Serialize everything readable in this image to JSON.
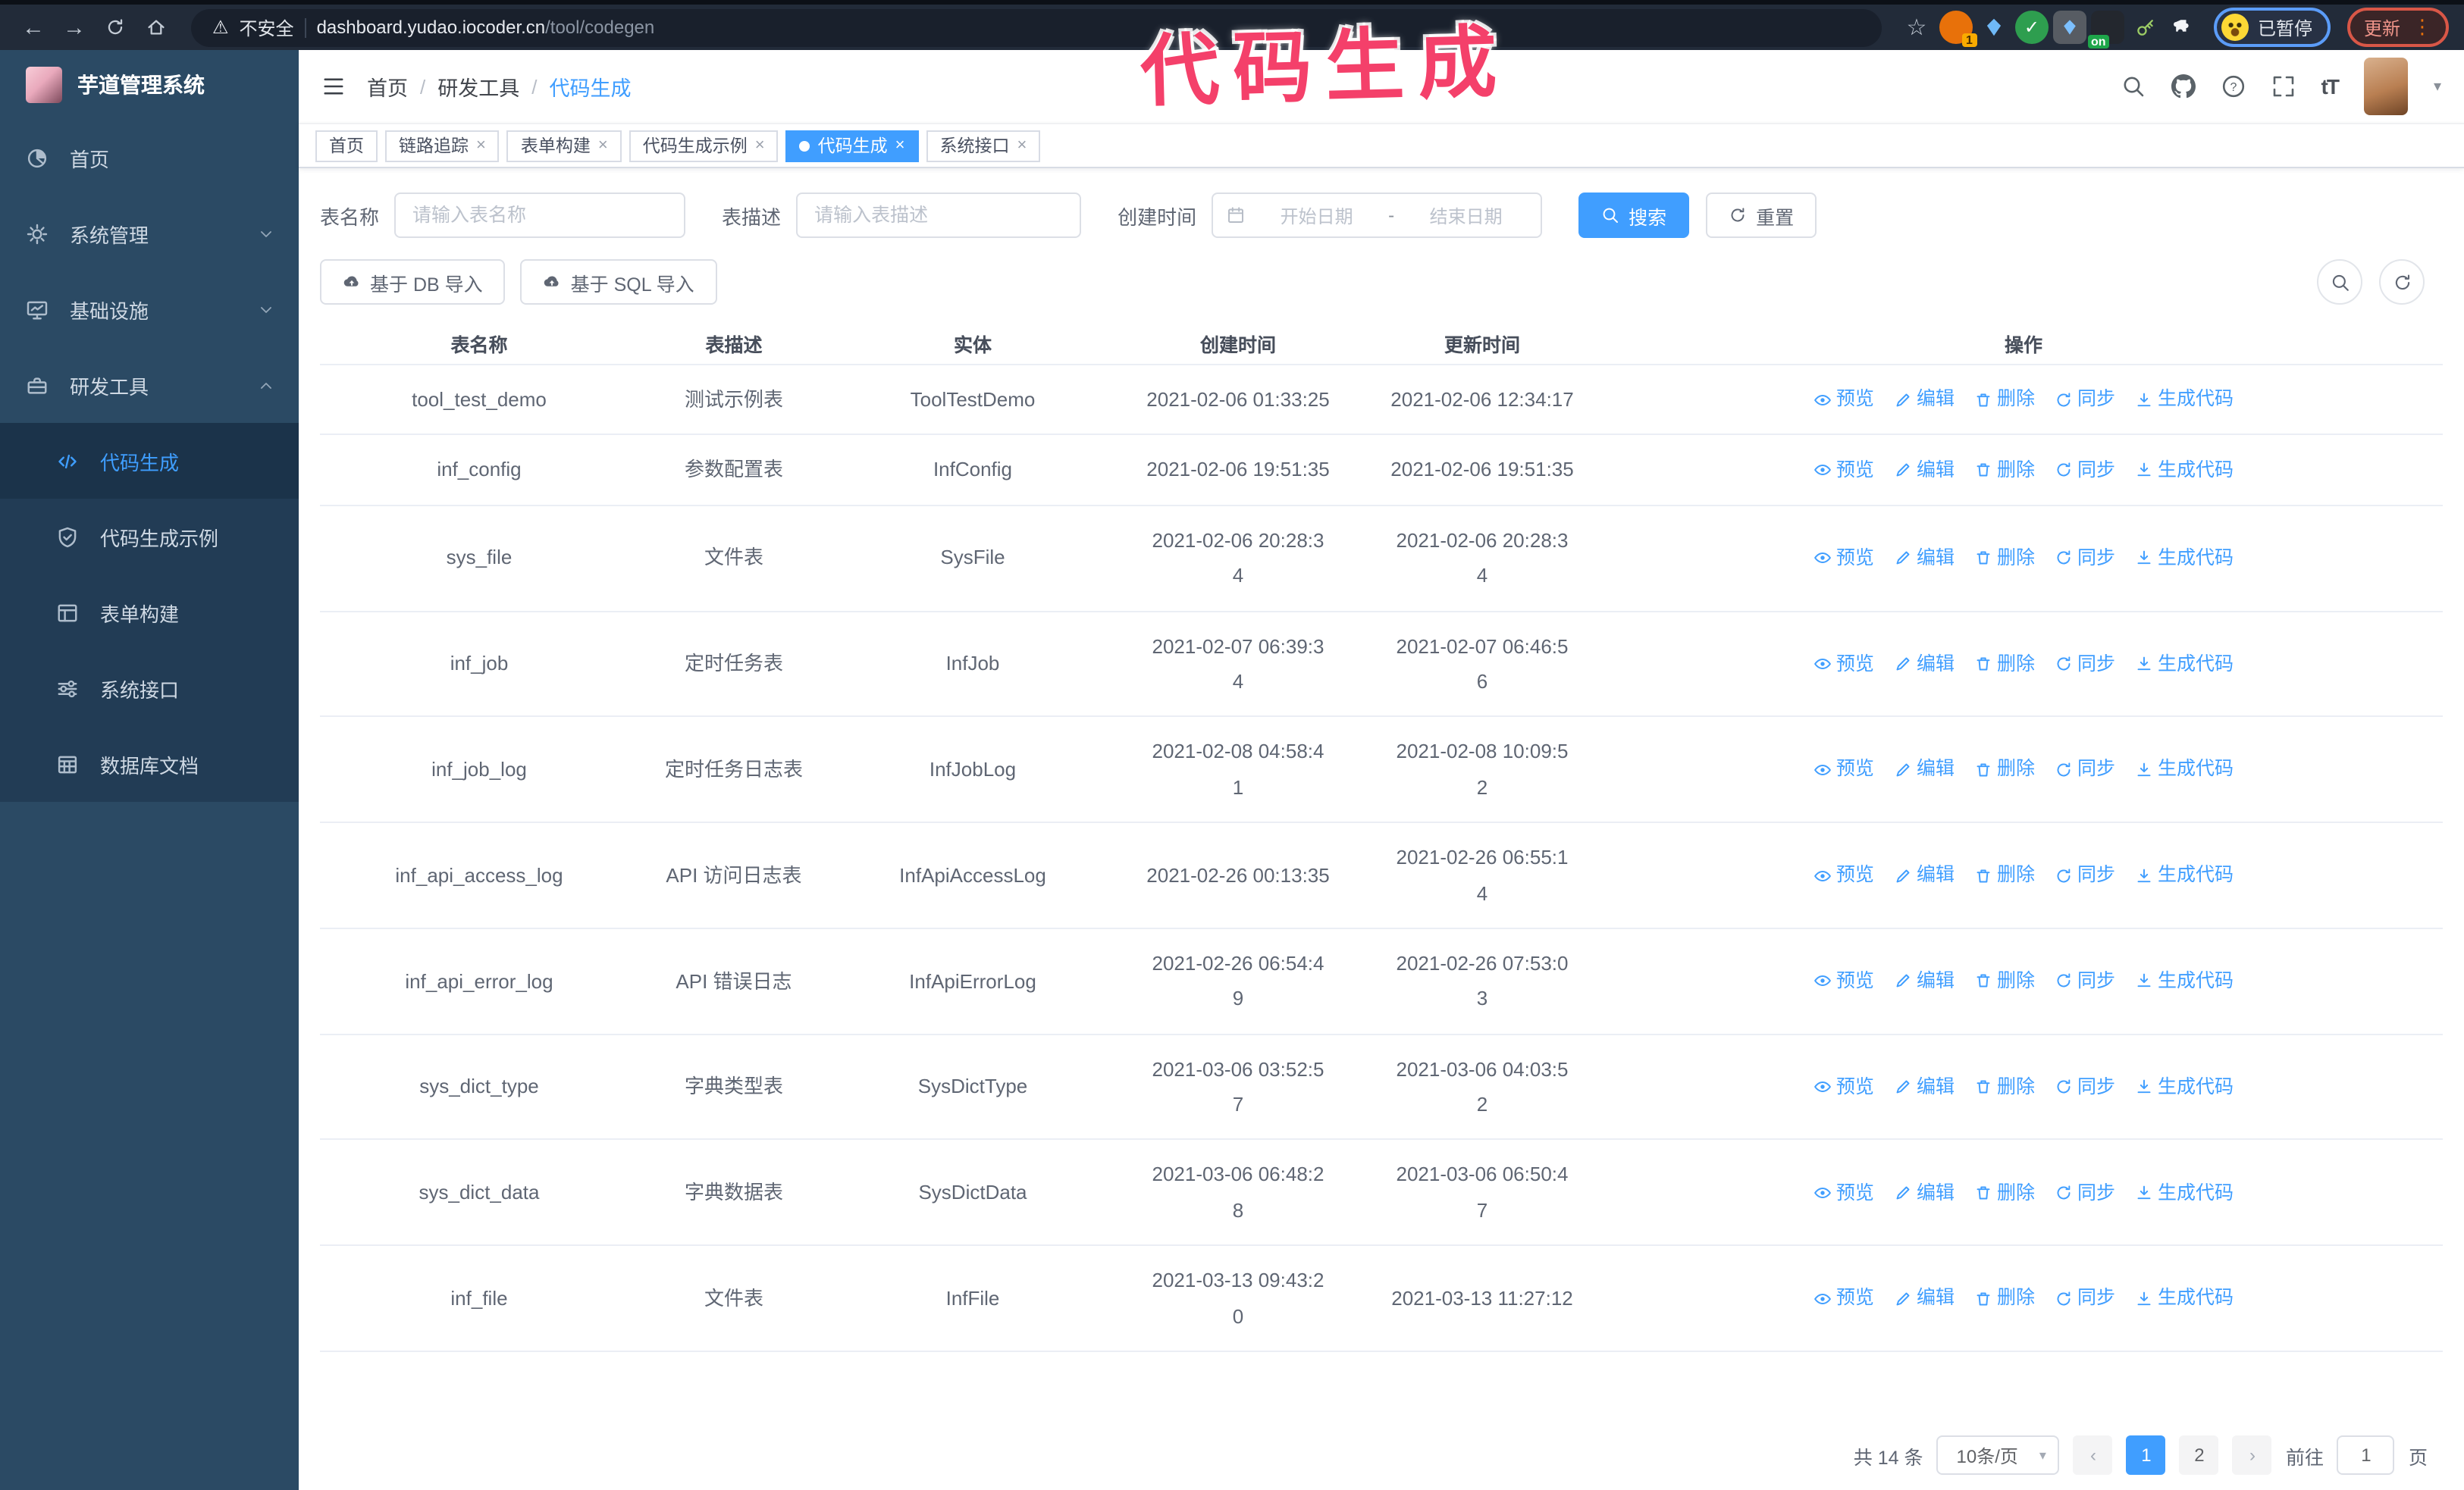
{
  "overlay": {
    "annotation": "代码生成"
  },
  "browser": {
    "security_label": "不安全",
    "url_host": "dashboard.yudao.iocoder.cn",
    "url_path": "/tool/codegen",
    "extension_badge": "1",
    "extension_on_badge": "on",
    "profile_label": "已暂停",
    "update_label": "更新"
  },
  "sidebar": {
    "app_title": "芋道管理系统",
    "items": [
      {
        "label": "首页",
        "icon": "dashboard-icon",
        "expandable": false,
        "expanded": false
      },
      {
        "label": "系统管理",
        "icon": "gear-icon",
        "expandable": true,
        "expanded": false
      },
      {
        "label": "基础设施",
        "icon": "monitor-icon",
        "expandable": true,
        "expanded": false
      },
      {
        "label": "研发工具",
        "icon": "toolbox-icon",
        "expandable": true,
        "expanded": true
      }
    ],
    "submenu": [
      {
        "label": "代码生成",
        "icon": "code-icon",
        "active": true
      },
      {
        "label": "代码生成示例",
        "icon": "shield-check-icon",
        "active": false
      },
      {
        "label": "表单构建",
        "icon": "form-icon",
        "active": false
      },
      {
        "label": "系统接口",
        "icon": "sliders-icon",
        "active": false
      },
      {
        "label": "数据库文档",
        "icon": "db-doc-icon",
        "active": false
      }
    ]
  },
  "header": {
    "breadcrumb": [
      "首页",
      "研发工具",
      "代码生成"
    ]
  },
  "tags": [
    {
      "label": "首页",
      "closable": false,
      "active": false
    },
    {
      "label": "链路追踪",
      "closable": true,
      "active": false
    },
    {
      "label": "表单构建",
      "closable": true,
      "active": false
    },
    {
      "label": "代码生成示例",
      "closable": true,
      "active": false
    },
    {
      "label": "代码生成",
      "closable": true,
      "active": true
    },
    {
      "label": "系统接口",
      "closable": true,
      "active": false
    }
  ],
  "search_form": {
    "table_name_label": "表名称",
    "table_name_placeholder": "请输入表名称",
    "table_desc_label": "表描述",
    "table_desc_placeholder": "请输入表描述",
    "create_time_label": "创建时间",
    "start_date_placeholder": "开始日期",
    "range_separator": "-",
    "end_date_placeholder": "结束日期",
    "search_label": "搜索",
    "reset_label": "重置"
  },
  "toolbar": {
    "import_db_label": "基于 DB 导入",
    "import_sql_label": "基于 SQL 导入"
  },
  "table": {
    "columns": [
      "表名称",
      "表描述",
      "实体",
      "创建时间",
      "更新时间",
      "操作"
    ],
    "actions": [
      "预览",
      "编辑",
      "删除",
      "同步",
      "生成代码"
    ],
    "rows": [
      {
        "name": "tool_test_demo",
        "desc": "测试示例表",
        "entity": "ToolTestDemo",
        "created": "2021-02-06 01:33:25",
        "updated": "2021-02-06 12:34:17"
      },
      {
        "name": "inf_config",
        "desc": "参数配置表",
        "entity": "InfConfig",
        "created": "2021-02-06 19:51:35",
        "updated": "2021-02-06 19:51:35"
      },
      {
        "name": "sys_file",
        "desc": "文件表",
        "entity": "SysFile",
        "created": "2021-02-06 20:28:3\n4",
        "updated": "2021-02-06 20:28:3\n4"
      },
      {
        "name": "inf_job",
        "desc": "定时任务表",
        "entity": "InfJob",
        "created": "2021-02-07 06:39:3\n4",
        "updated": "2021-02-07 06:46:5\n6"
      },
      {
        "name": "inf_job_log",
        "desc": "定时任务日志表",
        "entity": "InfJobLog",
        "created": "2021-02-08 04:58:4\n1",
        "updated": "2021-02-08 10:09:5\n2"
      },
      {
        "name": "inf_api_access_log",
        "desc": "API 访问日志表",
        "entity": "InfApiAccessLog",
        "created": "2021-02-26 00:13:35",
        "updated": "2021-02-26 06:55:1\n4"
      },
      {
        "name": "inf_api_error_log",
        "desc": "API 错误日志",
        "entity": "InfApiErrorLog",
        "created": "2021-02-26 06:54:4\n9",
        "updated": "2021-02-26 07:53:0\n3"
      },
      {
        "name": "sys_dict_type",
        "desc": "字典类型表",
        "entity": "SysDictType",
        "created": "2021-03-06 03:52:5\n7",
        "updated": "2021-03-06 04:03:5\n2"
      },
      {
        "name": "sys_dict_data",
        "desc": "字典数据表",
        "entity": "SysDictData",
        "created": "2021-03-06 06:48:2\n8",
        "updated": "2021-03-06 06:50:4\n7"
      },
      {
        "name": "inf_file",
        "desc": "文件表",
        "entity": "InfFile",
        "created": "2021-03-13 09:43:2\n0",
        "updated": "2021-03-13 11:27:12"
      }
    ]
  },
  "pagination": {
    "total_label": "共 14 条",
    "page_size": "10条/页",
    "pages": [
      "1",
      "2"
    ],
    "active_page": "1",
    "goto_label": "前往",
    "goto_value": "1",
    "page_label": "页"
  }
}
